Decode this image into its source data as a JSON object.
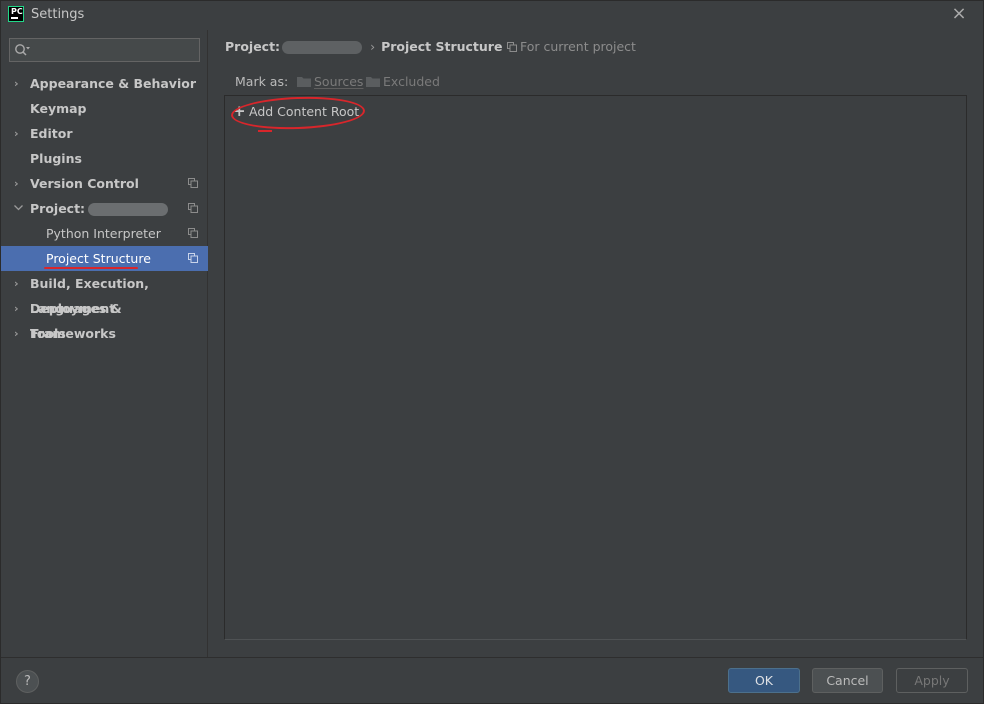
{
  "window": {
    "title": "Settings",
    "app_logo_text": "PC",
    "close_icon": "×"
  },
  "sidebar": {
    "search": {
      "value": "",
      "placeholder": ""
    },
    "items": [
      {
        "label": "Appearance & Behavior",
        "expandable": true
      },
      {
        "label": "Keymap",
        "expandable": false
      },
      {
        "label": "Editor",
        "expandable": true
      },
      {
        "label": "Plugins",
        "expandable": false
      },
      {
        "label": "Version Control",
        "expandable": true
      },
      {
        "label": "Project:",
        "expandable": true,
        "expanded": true
      },
      {
        "label": "Python Interpreter",
        "child": true
      },
      {
        "label": "Project Structure",
        "child": true,
        "selected": true
      },
      {
        "label": "Build, Execution, Deployment",
        "expandable": true
      },
      {
        "label": "Languages & Frameworks",
        "expandable": true
      },
      {
        "label": "Tools",
        "expandable": true
      }
    ],
    "chevron_right": "›",
    "chevron_down": "⌄"
  },
  "main": {
    "breadcrumb": {
      "project_label": "Project:",
      "separator": "›",
      "current": "Project Structure"
    },
    "scope_label": "For current project",
    "mark_as": {
      "label": "Mark as:",
      "sources": "Sources",
      "excluded": "Excluded"
    },
    "add_content_root": {
      "icon": "+",
      "label": "Add Content Root"
    }
  },
  "footer": {
    "help": "?",
    "ok": "OK",
    "cancel": "Cancel",
    "apply": "Apply"
  },
  "colors": {
    "background": "#3c3f41",
    "selection": "#4b6eaf",
    "primary_button": "#365880",
    "annotation_red": "#d8262b"
  }
}
